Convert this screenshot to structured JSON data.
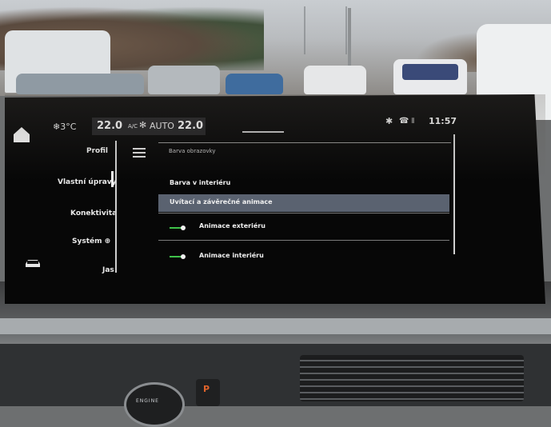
{
  "status_bar": {
    "outside_temp": "❄3°C",
    "climate": {
      "driver_temp": "22.0",
      "ac_label": "A/C",
      "fan_icon": "fan-icon",
      "auto_label": "AUTO",
      "passenger_temp": "22.0"
    },
    "bluetooth_icon": "bluetooth-icon",
    "phone_icon": "phone-icon",
    "signal_icon": "signal-icon",
    "clock": "11:57"
  },
  "sidebar": {
    "items": [
      {
        "label": "Profil"
      },
      {
        "label": "Vlastní úpravy",
        "active": true
      },
      {
        "label": "Konektivita"
      },
      {
        "label": "Systém ⊕"
      },
      {
        "label": "Jas"
      }
    ]
  },
  "content": {
    "section_title": "Barva obrazovky",
    "rows": [
      {
        "label": "Barva v interiéru"
      },
      {
        "label": "Uvítací a závěrečné animace",
        "highlighted": true
      },
      {
        "label": "Animace exteriéru",
        "toggle_on": true
      },
      {
        "label": "Animace interiéru",
        "toggle_on": true
      }
    ]
  },
  "colors": {
    "toggle_on": "#3fc24a",
    "highlight": "#5a6270",
    "park_button": "#e0632a"
  },
  "dashboard": {
    "engine_button_text": "ENGINE",
    "park_button_text": "P"
  }
}
